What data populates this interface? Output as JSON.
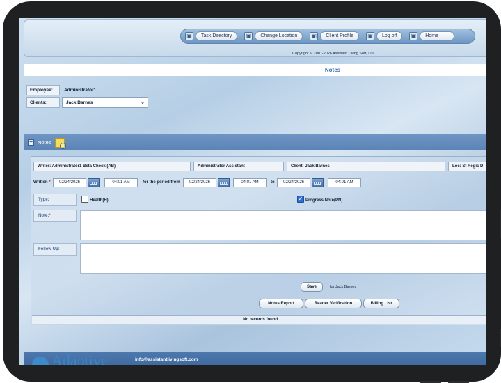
{
  "nav": {
    "items": [
      {
        "label": "Task Directory",
        "icon": "app-window-icon"
      },
      {
        "label": "Change Location",
        "icon": "app-window-icon"
      },
      {
        "label": "Client Profile",
        "icon": "app-window-icon"
      },
      {
        "label": "Log off",
        "icon": "app-window-icon"
      },
      {
        "label": "Home",
        "icon": "app-window-icon"
      }
    ],
    "copyright": "Copyright © 2007-2026 Assisted Living Soft, LLC."
  },
  "page": {
    "title": "Notes"
  },
  "employee": {
    "label": "Employee:",
    "value": "Administrator1"
  },
  "clients": {
    "label": "Clients:",
    "selected": "Jack Barnes"
  },
  "notes_band": {
    "label": "Notes"
  },
  "info": {
    "writer": "Writer: Administrator1 Beta Check (AB)",
    "role": "Administrator Assistant",
    "client": "Client: Jack Barnes",
    "loc": "Loc: St Regis D"
  },
  "dates": {
    "written_label": "Written",
    "written_date": "02/24/2026",
    "written_time": "04:01 AM",
    "period_label": "for the period from",
    "from_date": "02/24/2026",
    "from_time": "04:01 AM",
    "to_label": "to",
    "to_date": "02/24/2026",
    "to_time": "04:01 AM"
  },
  "type": {
    "label": "Type:",
    "health": {
      "label": "Health(H)",
      "checked": false
    },
    "progress": {
      "label": "Progress Note(PN)",
      "checked": true
    }
  },
  "note": {
    "label": "Note:",
    "value": ""
  },
  "follow_up": {
    "label": "Follow Up:",
    "value": ""
  },
  "save": {
    "label": "Save",
    "hint": "for Jack Barnes"
  },
  "reports": {
    "notes_report": "Notes Report",
    "reader_verification": "Reader Verification",
    "billing_list": "Billing List"
  },
  "records": {
    "empty": "No records found."
  },
  "footer": {
    "brand": "Adaptive",
    "email": "info@assistantlivingsoft.com"
  },
  "colors": {
    "accent": "#5a83b6",
    "title": "#3b6fa6",
    "required": "#d42020"
  }
}
